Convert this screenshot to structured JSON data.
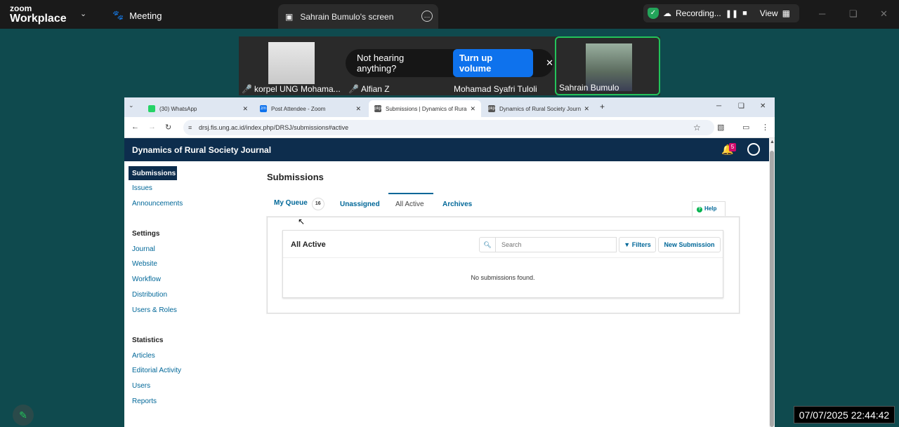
{
  "zoom": {
    "logo_line1": "zoom",
    "logo_line2": "Workplace",
    "meeting_label": "Meeting",
    "screen_tab_label": "Sahrain Bumulo's screen",
    "recording_label": "Recording...",
    "view_label": "View"
  },
  "participants": [
    {
      "name": "korpel UNG Mohama...",
      "muted": true
    },
    {
      "name": "Alfian Z",
      "muted": true
    },
    {
      "name": "Mohamad Syafri Tuloli",
      "muted": false
    },
    {
      "name": "Sahrain Bumulo",
      "muted": false
    }
  ],
  "toast": {
    "message": "Not hearing anything?",
    "button": "Turn up volume"
  },
  "browser": {
    "tabs": [
      {
        "title": "(30) WhatsApp",
        "icon": "whatsapp-icon",
        "color": "#25d366"
      },
      {
        "title": "Post Attendee - Zoom",
        "icon": "zoom-icon",
        "color": "#0e72ed"
      },
      {
        "title": "Submissions | Dynamics of Rura",
        "icon": "pkp-icon",
        "color": "#555555"
      },
      {
        "title": "Dynamics of Rural Society Journ",
        "icon": "pkp-icon",
        "color": "#555555"
      }
    ],
    "active_tab": 2,
    "url": "drsj.fis.ung.ac.id/index.php/DRSJ/submissions#active"
  },
  "ojs": {
    "journal_title": "Dynamics of Rural Society Journal",
    "notification_count": "5",
    "sidebar": {
      "active": "Submissions",
      "items1": [
        "Issues",
        "Announcements"
      ],
      "settings_heading": "Settings",
      "settings": [
        "Journal",
        "Website",
        "Workflow",
        "Distribution",
        "Users & Roles"
      ],
      "statistics_heading": "Statistics",
      "statistics": [
        "Articles",
        "Editorial Activity",
        "Users",
        "Reports"
      ]
    },
    "page_title": "Submissions",
    "tabs": {
      "my_queue": "My Queue",
      "my_queue_count": "16",
      "unassigned": "Unassigned",
      "all_active": "All Active",
      "archives": "Archives"
    },
    "help": "Help",
    "panel_title": "All Active",
    "search_placeholder": "Search",
    "filters": "Filters",
    "new_submission": "New Submission",
    "empty_message": "No submissions found."
  },
  "clock": "07/07/2025 22:44:42",
  "colors": {
    "zoom_green": "#23c35a",
    "ojs_navy": "#0d2d4d",
    "ojs_link": "#006798",
    "zoom_blue": "#0e72ed"
  }
}
